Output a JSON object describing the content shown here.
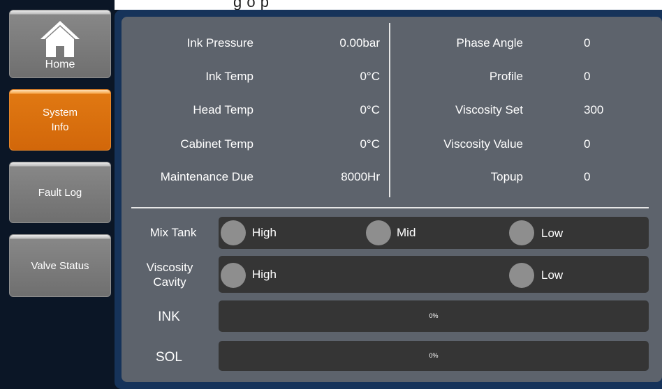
{
  "sidebar": {
    "items": [
      {
        "label": "Home",
        "icon": "home-icon",
        "active": false
      },
      {
        "label": "System\nInfo",
        "active": true
      },
      {
        "label": "Fault Log",
        "active": false
      },
      {
        "label": "Valve Status",
        "active": false
      }
    ]
  },
  "header": {
    "title": "g         o                 p"
  },
  "info": {
    "left": [
      {
        "label": "Ink Pressure",
        "value": "0.00bar"
      },
      {
        "label": "Ink Temp",
        "value": "0°C"
      },
      {
        "label": "Head Temp",
        "value": "0°C"
      },
      {
        "label": "Cabinet Temp",
        "value": "0°C"
      },
      {
        "label": "Maintenance Due",
        "value": "8000Hr"
      }
    ],
    "right": [
      {
        "label": "Phase Angle",
        "value": "0"
      },
      {
        "label": "Profile",
        "value": "0"
      },
      {
        "label": "Viscosity Set",
        "value": "300"
      },
      {
        "label": "Viscosity Value",
        "value": "0"
      },
      {
        "label": "Topup",
        "value": "0"
      }
    ]
  },
  "levels": {
    "mix_tank": {
      "label": "Mix Tank",
      "high": "High",
      "mid": "Mid",
      "low": "Low"
    },
    "viscosity_cavity": {
      "label": "Viscosity\nCavity",
      "high": "High",
      "low": "Low"
    },
    "ink": {
      "label": "INK",
      "percent_text": "0%",
      "fill": 0
    },
    "sol": {
      "label": "SOL",
      "percent_text": "0%",
      "fill": 0
    }
  },
  "colors": {
    "active_nav": "#d2670a",
    "panel": "#5d636c",
    "bar": "#353535",
    "indicator_off": "#8e8e8e"
  }
}
